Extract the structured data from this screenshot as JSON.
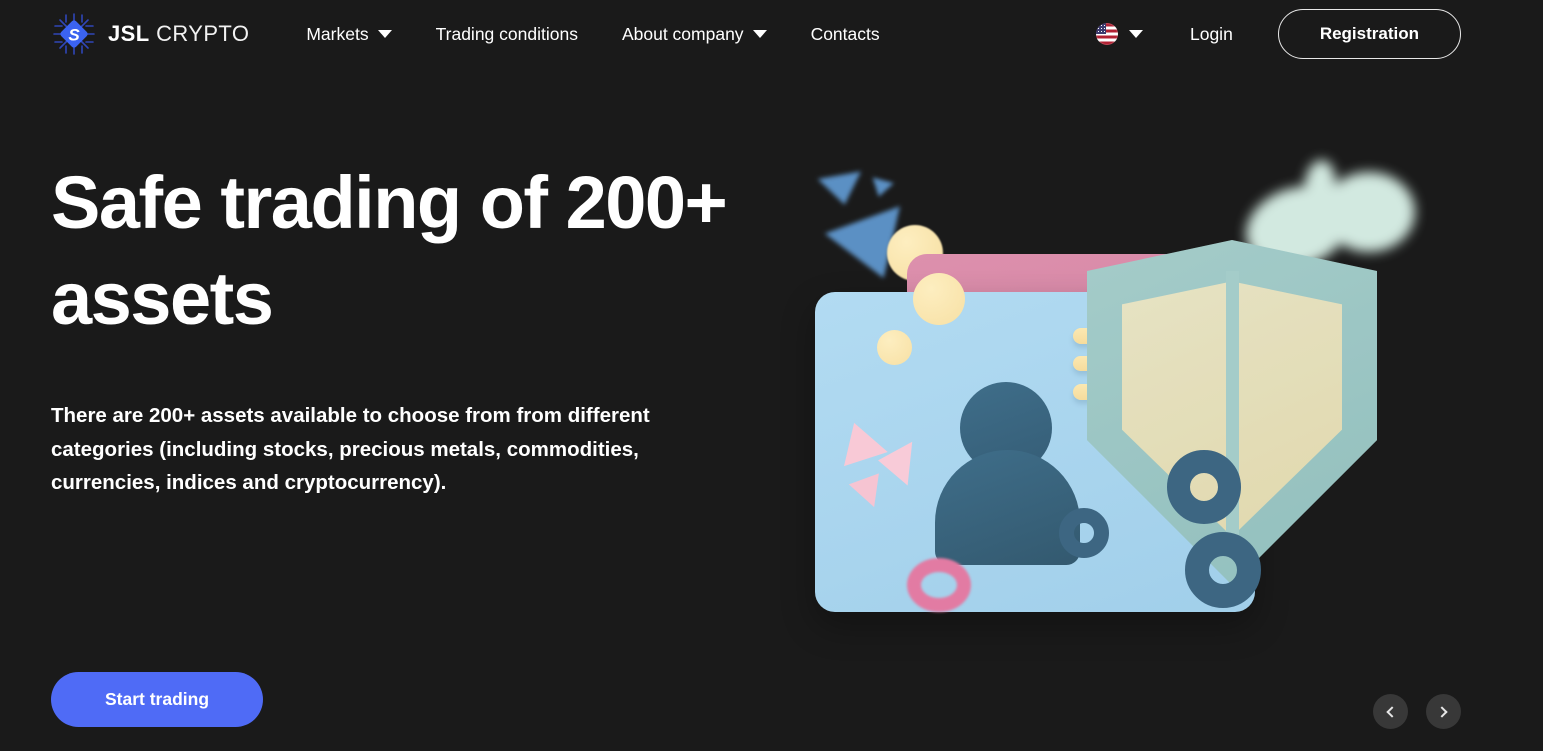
{
  "brand": {
    "name_bold": "JSL",
    "name_light": "CRYPTO",
    "logo_icon": "crypto-chip-logo-icon"
  },
  "nav": {
    "items": [
      {
        "label": "Markets",
        "has_dropdown": true,
        "caret_icon": "chevron-down-icon"
      },
      {
        "label": "Trading conditions",
        "has_dropdown": false
      },
      {
        "label": "About company",
        "has_dropdown": true,
        "caret_icon": "chevron-down-icon"
      },
      {
        "label": "Contacts",
        "has_dropdown": false
      }
    ]
  },
  "header_right": {
    "language": {
      "flag_icon": "us-flag-icon",
      "caret_icon": "chevron-down-icon"
    },
    "login_label": "Login",
    "registration_label": "Registration"
  },
  "hero": {
    "headline": "Safe trading of 200+ assets",
    "subtext": "There are 200+ assets available to choose from from different categories (including stocks, precious metals, commodities, currencies, indices and cryptocurrency).",
    "cta_label": "Start trading"
  },
  "carousel": {
    "prev_icon": "chevron-left-icon",
    "next_icon": "chevron-right-icon"
  },
  "illustration": {
    "alt": "pastel 3d shield and profile card composition",
    "elements": [
      "pink-card",
      "blue-profile-card",
      "person-avatar",
      "yellow-text-bars",
      "security-shield",
      "blue-torus-rings",
      "pink-triangles",
      "pink-ring",
      "yellow-spheres",
      "mint-cloud",
      "blue-triangles"
    ]
  },
  "colors": {
    "background": "#1a1a1a",
    "accent": "#4f6bf6",
    "text": "#ffffff",
    "card_pink": "#d98aa8",
    "card_blue": "#a8d4ee",
    "shield_teal": "#9cc9c4",
    "shield_cream": "#f7e2a8",
    "avatar_teal": "#3a6680",
    "ring_pink": "#e27ba3",
    "arrow_bg": "#383838"
  }
}
